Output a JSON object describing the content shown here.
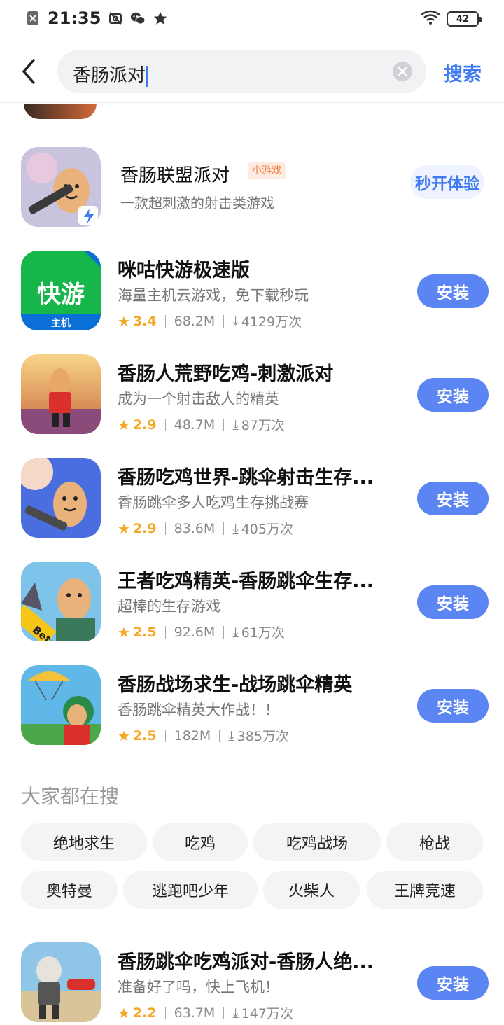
{
  "status_bar": {
    "time": "21:35",
    "battery": "42",
    "icons": [
      "sim-x-icon",
      "no-photo-icon",
      "wechat-icon",
      "star-icon",
      "wifi-icon",
      "battery-icon"
    ]
  },
  "search": {
    "query": "香肠派对",
    "submit_label": "搜索"
  },
  "mini_game": {
    "name": "香肠联盟派对",
    "tag": "小游戏",
    "description": "一款超刺激的射击类游戏",
    "button": "秒开体验"
  },
  "apps": [
    {
      "name": "咪咕快游极速版",
      "description": "海量主机云游戏，免下载秒玩",
      "rating": "3.4",
      "size": "68.2M",
      "downloads": "4129万次",
      "button": "安装"
    },
    {
      "name": "香肠人荒野吃鸡-刺激派对",
      "description": "成为一个射击敌人的精英",
      "rating": "2.9",
      "size": "48.7M",
      "downloads": "87万次",
      "button": "安装"
    },
    {
      "name": "香肠吃鸡世界-跳伞射击生存...",
      "description": "香肠跳伞多人吃鸡生存挑战赛",
      "rating": "2.9",
      "size": "83.6M",
      "downloads": "405万次",
      "button": "安装"
    },
    {
      "name": "王者吃鸡精英-香肠跳伞生存...",
      "description": "超棒的生存游戏",
      "rating": "2.5",
      "size": "92.6M",
      "downloads": "61万次",
      "button": "安装"
    },
    {
      "name": "香肠战场求生-战场跳伞精英",
      "description": "香肠跳伞精英大作战！！",
      "rating": "2.5",
      "size": "182M",
      "downloads": "385万次",
      "button": "安装"
    }
  ],
  "popular": {
    "title": "大家都在搜",
    "chips": [
      "绝地求生",
      "吃鸡",
      "吃鸡战场",
      "枪战",
      "奥特曼",
      "逃跑吧少年",
      "火柴人",
      "王牌竞速"
    ]
  },
  "bottom_app": {
    "name": "香肠跳伞吃鸡派对-香肠人绝...",
    "description": "准备好了吗，快上飞机！",
    "rating": "2.2",
    "size": "63.7M",
    "downloads": "147万次",
    "button": "安装"
  },
  "icon_texts": {
    "migu_main": "快游",
    "migu_sub": "主机",
    "beta": "Beta"
  },
  "colors": {
    "accent": "#3f7bf0",
    "install_bg": "#5b85f2",
    "rating": "#f5a623",
    "tag": "#f07a3c"
  }
}
